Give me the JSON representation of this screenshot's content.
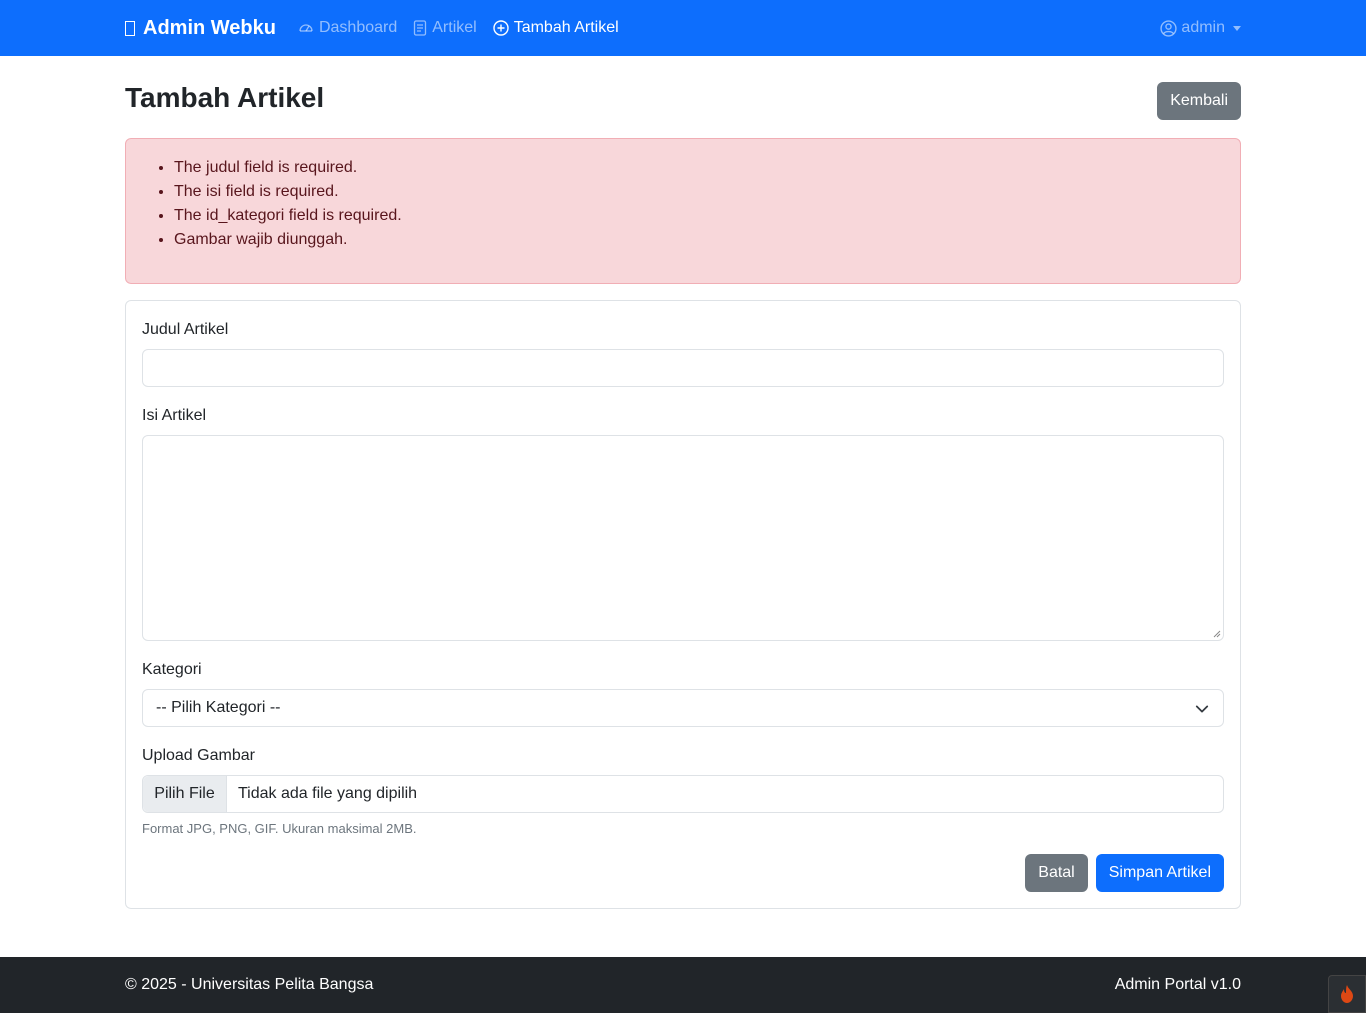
{
  "nav": {
    "brand": "Admin Webku",
    "items": [
      {
        "label": "Dashboard",
        "icon": "speedometer-icon"
      },
      {
        "label": "Artikel",
        "icon": "document-icon"
      },
      {
        "label": "Tambah Artikel",
        "icon": "plus-circle-icon"
      }
    ],
    "user": "admin"
  },
  "page": {
    "title": "Tambah Artikel",
    "back_label": "Kembali"
  },
  "errors": [
    "The judul field is required.",
    "The isi field is required.",
    "The id_kategori field is required.",
    "Gambar wajib diunggah."
  ],
  "form": {
    "judul_label": "Judul Artikel",
    "judul_value": "",
    "isi_label": "Isi Artikel",
    "isi_value": "",
    "kategori_label": "Kategori",
    "kategori_selected": "-- Pilih Kategori --",
    "upload_label": "Upload Gambar",
    "file_button": "Pilih File",
    "file_status": "Tidak ada file yang dipilih",
    "upload_help": "Format JPG, PNG, GIF. Ukuran maksimal 2MB.",
    "cancel_label": "Batal",
    "submit_label": "Simpan Artikel"
  },
  "footer": {
    "left": "© 2025 - Universitas Pelita Bangsa",
    "right": "Admin Portal v1.0"
  },
  "colors": {
    "primary": "#0d6efd",
    "secondary": "#6c757d",
    "danger_bg": "#f8d7da",
    "danger_text": "#58151c",
    "footer_bg": "#212529"
  }
}
